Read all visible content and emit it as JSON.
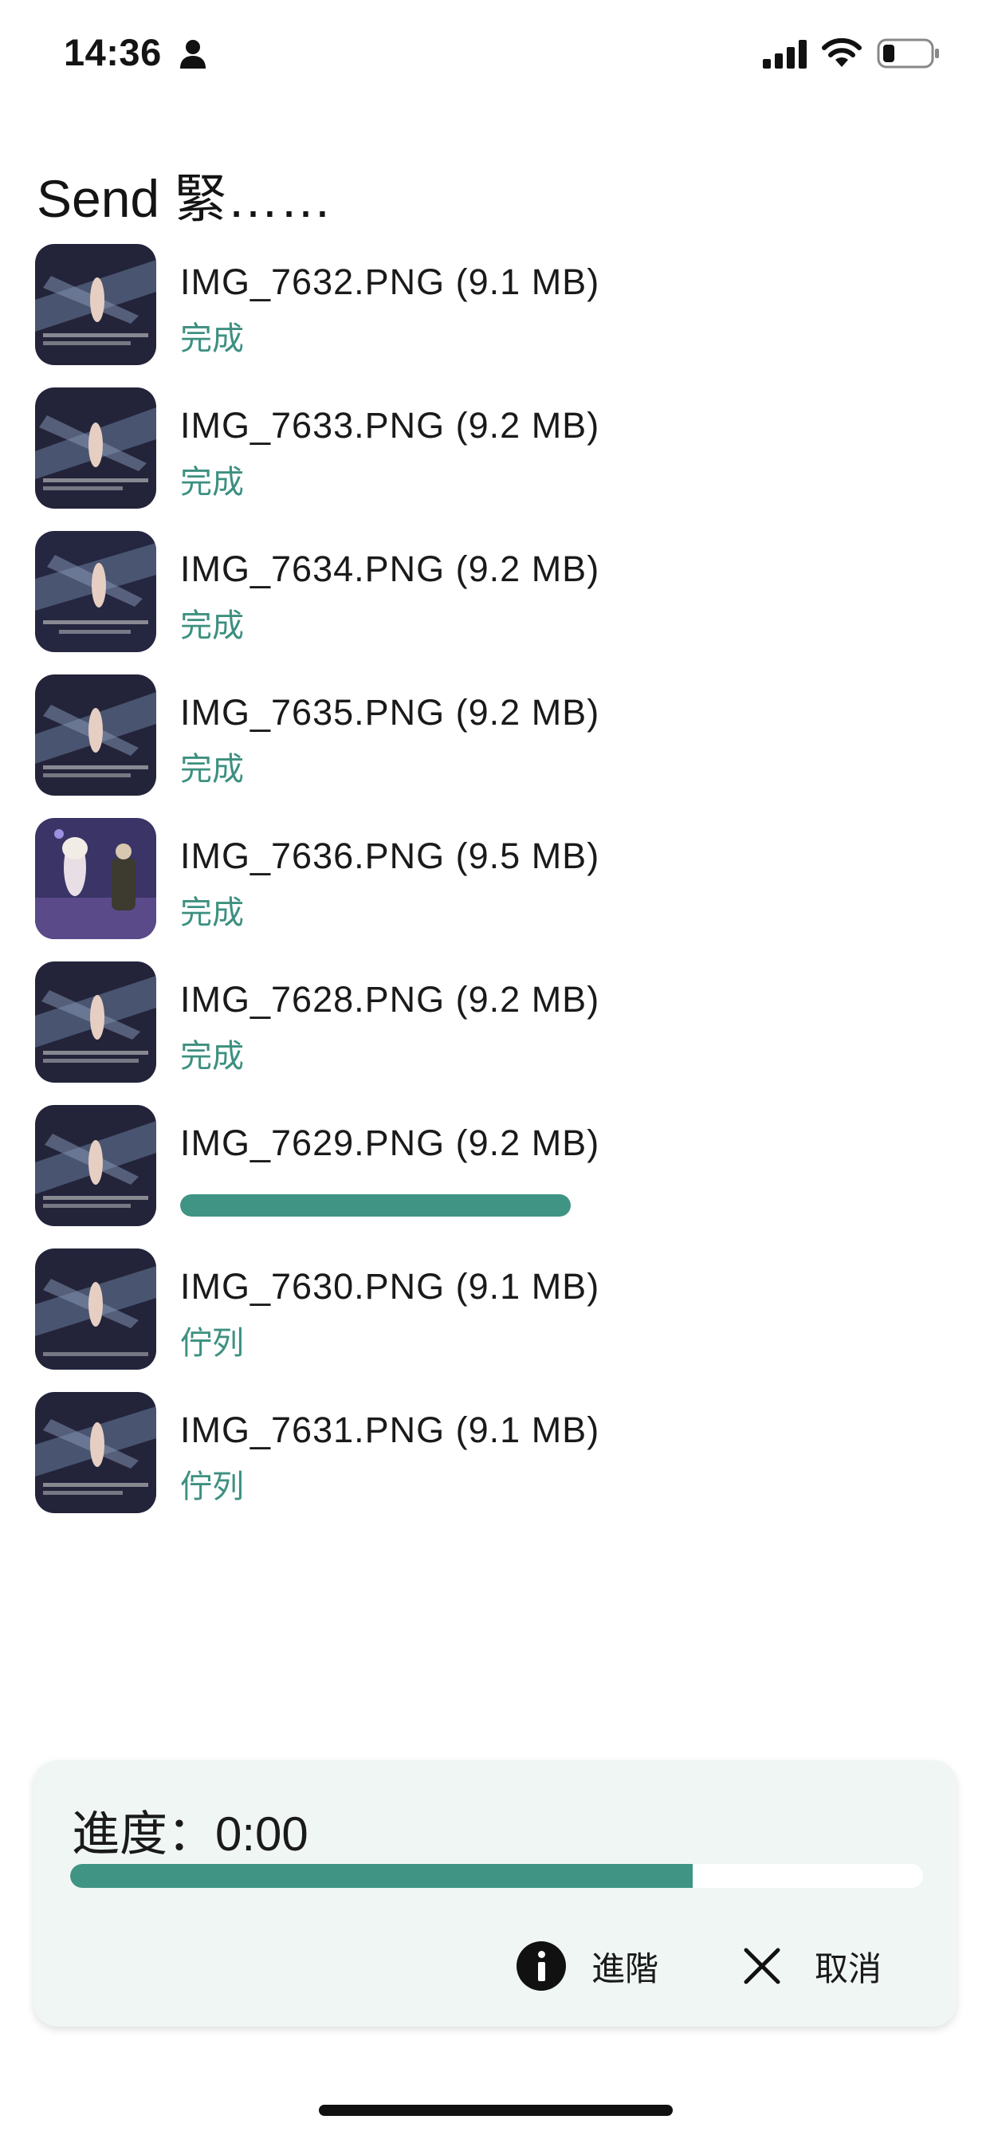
{
  "status_bar": {
    "time": "14:36",
    "icons": [
      "person-icon",
      "signal-icon",
      "wifi-icon",
      "battery-icon"
    ]
  },
  "title": "Send 緊……",
  "colors": {
    "accent": "#3f9484",
    "status_text": "#3d9080",
    "panel_bg": "#f0f6f4"
  },
  "files": [
    {
      "name": "IMG_7632.PNG (9.1 MB)",
      "status": "完成",
      "thumb": "dark-scene"
    },
    {
      "name": "IMG_7633.PNG (9.2 MB)",
      "status": "完成",
      "thumb": "dark-scene"
    },
    {
      "name": "IMG_7634.PNG (9.2 MB)",
      "status": "完成",
      "thumb": "dark-scene"
    },
    {
      "name": "IMG_7635.PNG (9.2 MB)",
      "status": "完成",
      "thumb": "dark-scene"
    },
    {
      "name": "IMG_7636.PNG (9.5 MB)",
      "status": "完成",
      "thumb": "purple-scene"
    },
    {
      "name": "IMG_7628.PNG (9.2 MB)",
      "status": "完成",
      "thumb": "dark-scene"
    },
    {
      "name": "IMG_7629.PNG (9.2 MB)",
      "status": "",
      "progress": 1.0,
      "thumb": "dark-scene"
    },
    {
      "name": "IMG_7630.PNG (9.1 MB)",
      "status": "佇列",
      "thumb": "dark-scene"
    },
    {
      "name": "IMG_7631.PNG (9.1 MB)",
      "status": "佇列",
      "thumb": "dark-scene"
    }
  ],
  "panel": {
    "progress_label": "進度：0:00",
    "total_progress": 0.73,
    "advanced_label": "進階",
    "cancel_label": "取消"
  }
}
